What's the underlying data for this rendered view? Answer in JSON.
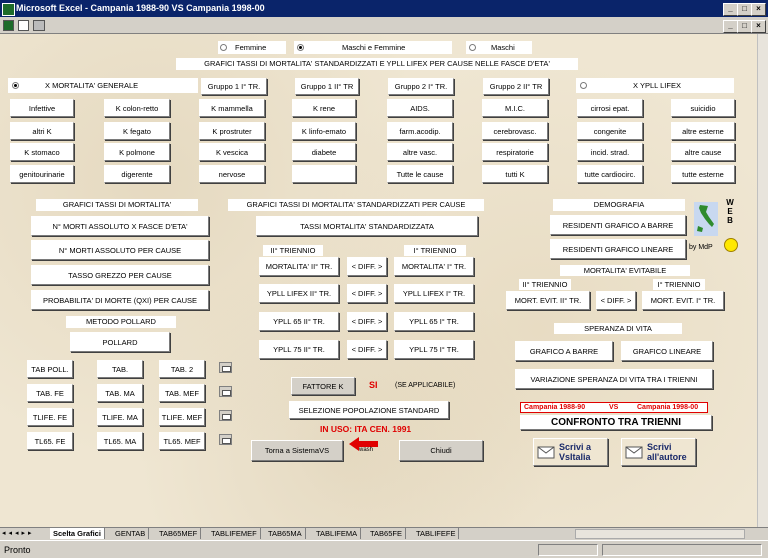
{
  "window": {
    "title": "Microsoft Excel - Campania 1988-90 VS Campania 1998-00"
  },
  "radios_sex": [
    {
      "label": "Femmine",
      "selected": false
    },
    {
      "label": "Maschi e Femmine",
      "selected": true
    },
    {
      "label": "Maschi",
      "selected": false
    }
  ],
  "main_header": "GRAFICI TASSI DI MORTALITA' STANDARDIZZATI E YPLL LIFEX PER CAUSE NELLE FASCE D'ETA'",
  "mode": {
    "mortality": "X MORTALITA' GENERALE",
    "ypll": "X YPLL LIFEX"
  },
  "groups": [
    "Gruppo 1 I° TR.",
    "Gruppo 1 II° TR",
    "Gruppo 2 I° TR.",
    "Gruppo 2 II° TR"
  ],
  "causes": [
    [
      "Infettive",
      "K colon-retto",
      "K mammella",
      "K rene",
      "AIDS.",
      "M.I.C.",
      "cirrosi epat.",
      "suicidio"
    ],
    [
      "altri K",
      "K fegato",
      "K prostruter",
      "K linfo-emato",
      "farm.acodip.",
      "cerebrovasc.",
      "congenite",
      "altre esterne"
    ],
    [
      "K stomaco",
      "K polmone",
      "K vescica",
      "diabete",
      "altre vasc.",
      "respiratorie",
      "incid. strad.",
      "altre cause"
    ],
    [
      "genitourinarie",
      "digerente",
      "nervose",
      "",
      "Tutte le cause",
      "tutti K",
      "tutte cardiocirc.",
      "tutte esterne"
    ]
  ],
  "left": {
    "header": "GRAFICI TASSI DI MORTALITA'",
    "buttons": [
      "N° MORTI ASSOLUTO X FASCE D'ETA'",
      "N° MORTI ASSOLUTO PER CAUSE",
      "TASSO GREZZO PER CAUSE",
      "PROBABILITA' DI MORTE (QXI) PER CAUSE"
    ],
    "pollard_header": "METODO POLLARD",
    "pollard": "POLLARD",
    "tables": [
      [
        "TAB POLL.",
        "TAB.",
        "TAB. 2"
      ],
      [
        "TAB. FE",
        "TAB. MA",
        "TAB. MEF"
      ],
      [
        "TLIFE. FE",
        "TLIFE. MA",
        "TLIFE. MEF"
      ],
      [
        "TL65. FE",
        "TL65. MA",
        "TL65. MEF"
      ]
    ]
  },
  "center": {
    "header": "GRAFICI TASSI DI MORTALITA' STANDARDIZZATI PER CAUSE",
    "std_button": "TASSI MORTALITA' STANDARDIZZATA",
    "tri2": "II° TRIENNIO",
    "tri1": "I° TRIENNIO",
    "rows": [
      [
        "MORTALITA' II° TR.",
        "< DIFF. >",
        "MORTALITA' I° TR."
      ],
      [
        "YPLL LIFEX II° TR.",
        "< DIFF. >",
        "YPLL LIFEX I° TR."
      ],
      [
        "YPLL 65 II° TR.",
        "< DIFF. >",
        "YPLL 65 I° TR."
      ],
      [
        "YPLL 75 II° TR.",
        "< DIFF. >",
        "YPLL 75 I° TR."
      ]
    ],
    "fattore": "FATTORE K",
    "si": "SI",
    "applicable": "(SE APPLICABILE)",
    "selezione": "SELEZIONE POPOLAZIONE STANDARD",
    "in_uso": "IN USO:  ITA CEN. 1991",
    "torna": "Torna a SistemaVS",
    "wash": "wash",
    "chiudi": "Chiudi"
  },
  "right": {
    "demografia": "DEMOGRAFIA",
    "abarre": "RESIDENTI GRAFICO A BARRE",
    "lineare": "RESIDENTI GRAFICO LINEARE",
    "web": "W E B",
    "bymdp": "by MdP",
    "evitabile": "MORTALITA' EVITABILE",
    "tri2": "II° TRIENNIO",
    "tri1": "I° TRIENNIO",
    "mort2": "MORT. EVIT. II° TR.",
    "diff": "< DIFF. >",
    "mort1": "MORT. EVIT. I° TR.",
    "speranza": "SPERANZA DI VITA",
    "sp_barre": "GRAFICO A BARRE",
    "sp_lin": "GRAFICO LINEARE",
    "variazione": "VARIAZIONE SPERANZA DI VITA TRA I TRIENNI",
    "camp1": "Campania   1988-90",
    "vs": "VS",
    "camp2": "Campania   1998-00",
    "confronto": "CONFRONTO  TRA  TRIENNI",
    "scrivi1": "Scrivi a VsItalia",
    "scrivi2": "Scrivi all'autore"
  },
  "tabs": [
    "Scelta Grafici",
    "GENTAB",
    "TAB65MEF",
    "TABLIFEMEF",
    "TAB65MA",
    "TABLIFEMA",
    "TAB65FE",
    "TABLIFEFE"
  ],
  "status": "Pronto"
}
